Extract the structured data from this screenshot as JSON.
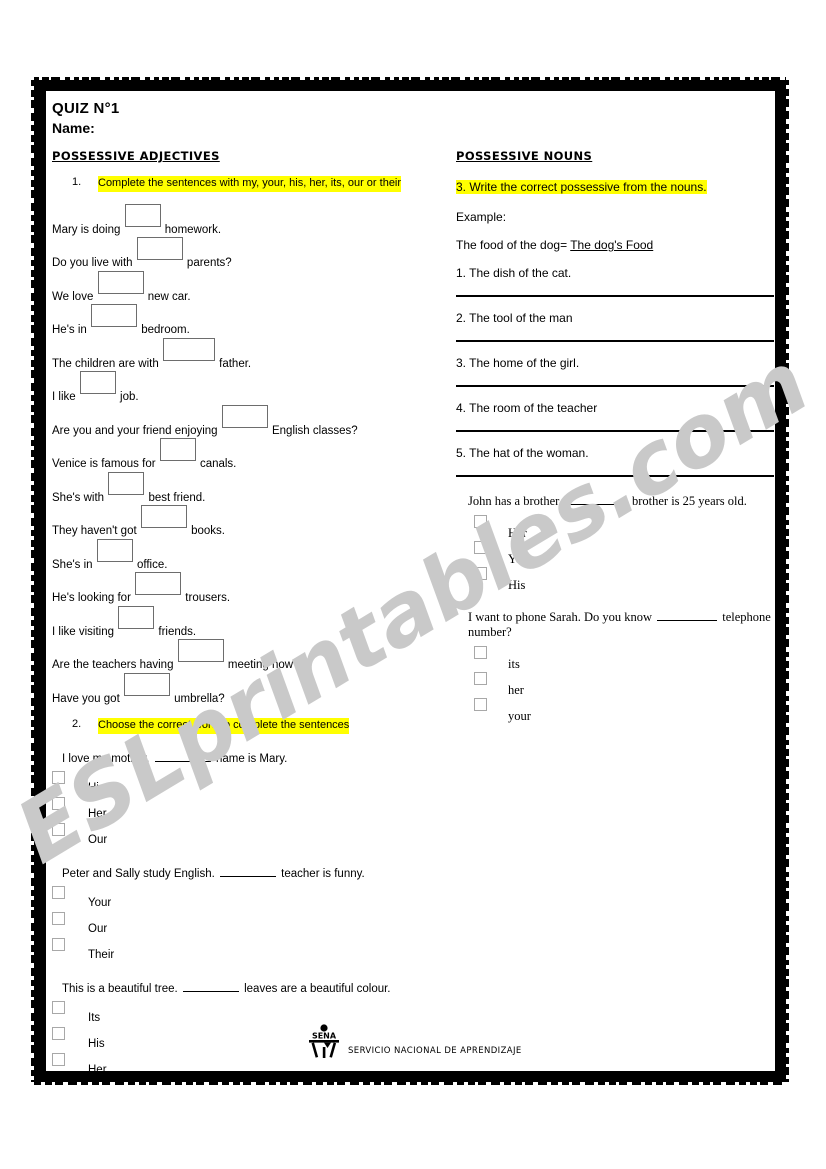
{
  "document": {
    "title": "QUIZ N°1",
    "name_label": "Name:",
    "watermark": "ESLprintables.com",
    "highlight_color": "#ffff00"
  },
  "left_column": {
    "section_heading": "POSSESSIVE ADJECTIVES",
    "exercise1": {
      "number": "1.",
      "instruction": "Complete the sentences with my, your, his, her, its, our or their",
      "sentences": [
        {
          "before": "Mary is doing",
          "after": "homework.",
          "box": "narrow"
        },
        {
          "before": "Do you live with",
          "after": "parents?",
          "box": "wide"
        },
        {
          "before": "We love",
          "after": "new car.",
          "box": "wide"
        },
        {
          "before": "He's in",
          "after": "bedroom.",
          "box": "wide"
        },
        {
          "before": "The children are with",
          "after": "father.",
          "box": "xwide"
        },
        {
          "before": "I like",
          "after": "job.",
          "box": "narrow"
        },
        {
          "before": "Are you and your friend enjoying",
          "after": "English classes?",
          "box": "wide"
        },
        {
          "before": "Venice is famous for",
          "after": "canals.",
          "box": "narrow"
        },
        {
          "before": "She's with",
          "after": "best friend.",
          "box": "narrow"
        },
        {
          "before": "They haven't got",
          "after": "books.",
          "box": "wide"
        },
        {
          "before": "She's in",
          "after": "office.",
          "box": "narrow"
        },
        {
          "before": "He's looking for",
          "after": "trousers.",
          "box": "wide"
        },
        {
          "before": "I like visiting",
          "after": "friends.",
          "box": "narrow"
        },
        {
          "before": "Are the teachers having",
          "after": "meeting now?",
          "box": "wide"
        },
        {
          "before": "Have you got",
          "after": "umbrella?",
          "box": "wide"
        }
      ]
    },
    "exercise2": {
      "number": "2.",
      "instruction": "Choose the correct word to complete the sentences",
      "questions": [
        {
          "before": "I love my mother.",
          "after": "name is Mary.",
          "options": [
            "His",
            "Her",
            "Our"
          ]
        },
        {
          "before": "Peter and Sally study English.",
          "after": "teacher is funny.",
          "options": [
            "Your",
            "Our",
            "Their"
          ]
        },
        {
          "before": "This is a beautiful tree.",
          "after": "leaves are a beautiful colour.",
          "options": [
            "Its",
            "His",
            "Her"
          ]
        }
      ]
    }
  },
  "right_column": {
    "section_heading": "POSSESSIVE NOUNS",
    "exercise3": {
      "instruction": "3. Write the correct possessive from the nouns.",
      "example_label": "Example:",
      "example_prompt": "The food of the dog=",
      "example_answer": "The dog's Food",
      "items": [
        "1. The dish of the cat.",
        "2.  The tool of the man",
        "3. The home of the girl.",
        "4. The room of the teacher",
        "5.  The hat of the woman."
      ]
    },
    "questions": [
      {
        "before": "John has a brother.",
        "after": "brother is 25 years old.",
        "options": [
          "Her",
          "Your",
          "His"
        ]
      },
      {
        "before": "I want to phone Sarah. Do you know",
        "after": "telephone number?",
        "options": [
          "its",
          "her",
          "your"
        ]
      }
    ]
  },
  "footer": {
    "logo_text": "SENA",
    "organization": "SERVICIO NACIONAL DE APRENDIZAJE"
  }
}
